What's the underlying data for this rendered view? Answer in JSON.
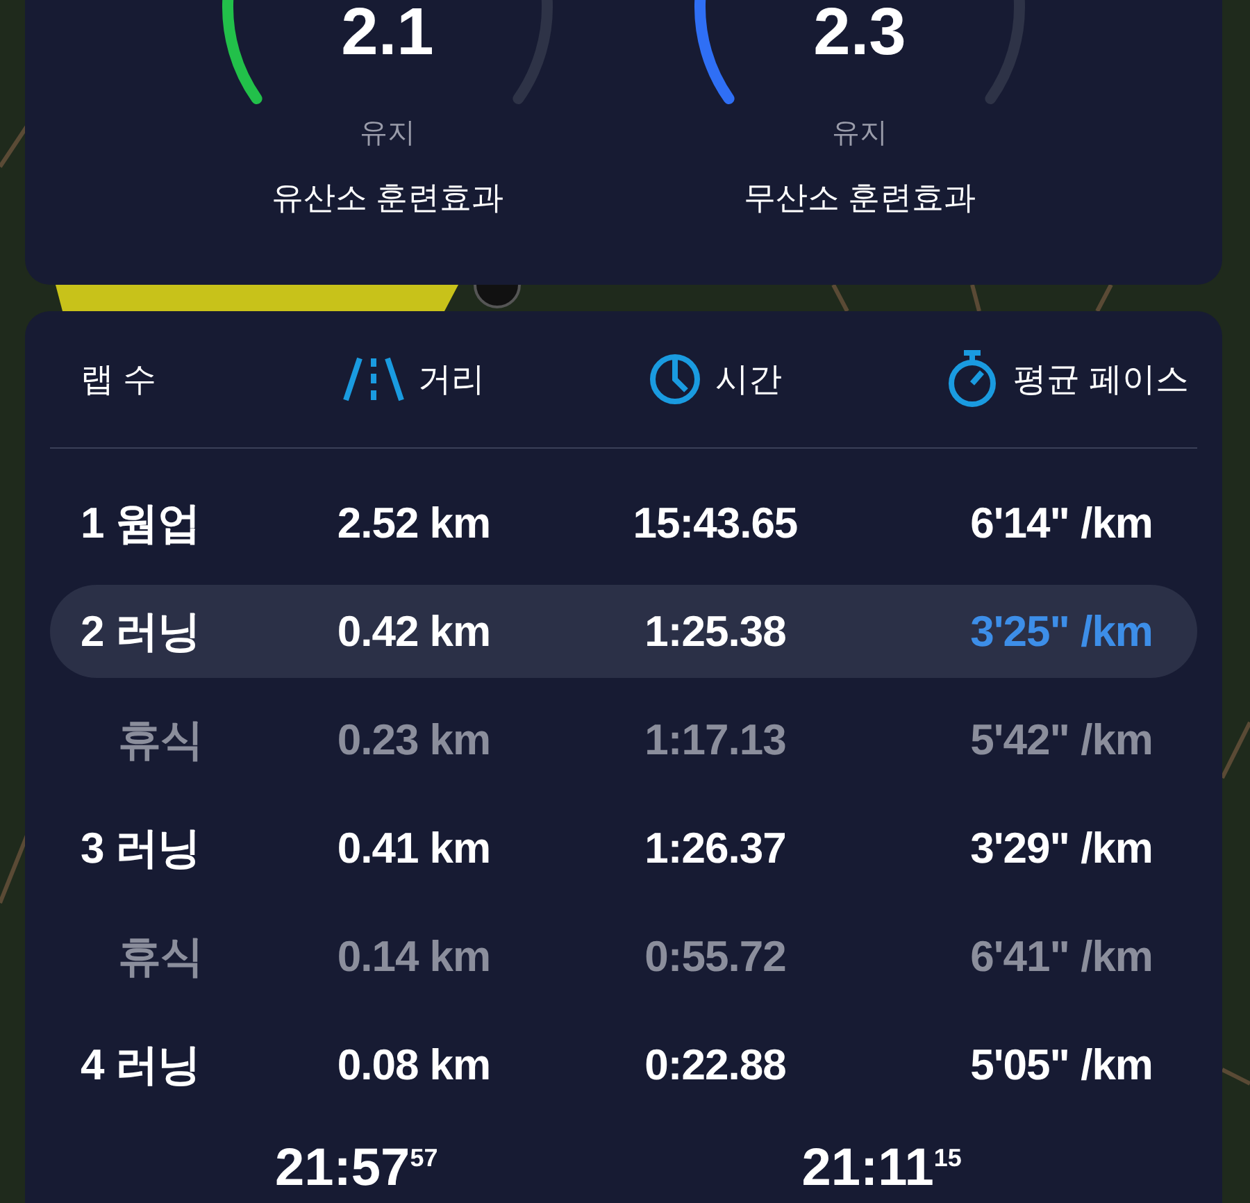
{
  "training_effects": [
    {
      "value": "2.1",
      "status": "유지",
      "label": "유산소 훈련효과",
      "color": "#22c04a"
    },
    {
      "value": "2.3",
      "status": "유지",
      "label": "무산소 훈련효과",
      "color": "#2f6ff5"
    }
  ],
  "laps_table": {
    "columns": [
      {
        "label": "랩 수",
        "kind": "lap"
      },
      {
        "label": "거리",
        "kind": "distance"
      },
      {
        "label": "시간",
        "kind": "time"
      },
      {
        "label": "평균 페이스",
        "kind": "pace"
      }
    ],
    "rows": [
      {
        "kind": "lap",
        "lap": "1 웜업",
        "distance": "2.52 km",
        "time": "15:43.65",
        "pace": "6'14\" /km",
        "selected": false
      },
      {
        "kind": "lap",
        "lap": "2 러닝",
        "distance": "0.42 km",
        "time": "1:25.38",
        "pace": "3'25\" /km",
        "selected": true
      },
      {
        "kind": "rest",
        "lap": "휴식",
        "distance": "0.23 km",
        "time": "1:17.13",
        "pace": "5'42\" /km",
        "selected": false
      },
      {
        "kind": "lap",
        "lap": "3 러닝",
        "distance": "0.41 km",
        "time": "1:26.37",
        "pace": "3'29\" /km",
        "selected": false
      },
      {
        "kind": "rest",
        "lap": "휴식",
        "distance": "0.14 km",
        "time": "0:55.72",
        "pace": "6'41\" /km",
        "selected": false
      },
      {
        "kind": "lap",
        "lap": "4 러닝",
        "distance": "0.08 km",
        "time": "0:22.88",
        "pace": "5'05\" /km",
        "selected": false
      }
    ]
  },
  "totals": [
    "21:57$^{57}$",
    "21:11$^{15}$"
  ]
}
